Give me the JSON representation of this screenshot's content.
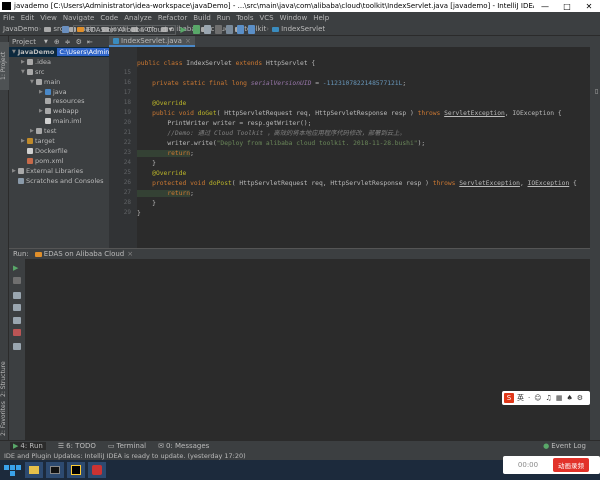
{
  "window": {
    "title": "javademo [C:\\Users\\Administrator\\idea-workspace\\javaDemo] - ...\\src\\main\\java\\com\\alibaba\\cloud\\toolkit\\IndexServlet.java [javademo] - IntelliJ IDEA (Admi...",
    "minimize": "—",
    "maximize": "□",
    "close": "✕"
  },
  "menu": [
    "File",
    "Edit",
    "View",
    "Navigate",
    "Code",
    "Analyze",
    "Refactor",
    "Build",
    "Run",
    "Tools",
    "VCS",
    "Window",
    "Help"
  ],
  "breadcrumbs": [
    "JavaDemo",
    "src",
    "main",
    "java",
    "com",
    "alibaba",
    "cloud",
    "toolkit",
    "IndexServlet"
  ],
  "run_config": "EDAS on Alibaba Cloud",
  "project_panel": {
    "title": "Project",
    "tree": [
      {
        "indent": 0,
        "arrow": "▼",
        "label": "JavaDemo",
        "sub": "C:\\Users\\Administrator\\idea-workspace\\JavaDemo",
        "icon": "folder",
        "selected": true
      },
      {
        "indent": 1,
        "arrow": "▶",
        "label": ".idea",
        "icon": "folder"
      },
      {
        "indent": 1,
        "arrow": "▼",
        "label": "src",
        "icon": "folder"
      },
      {
        "indent": 2,
        "arrow": "▼",
        "label": "main",
        "icon": "folder"
      },
      {
        "indent": 3,
        "arrow": "▶",
        "label": "java",
        "icon": "folder-blue"
      },
      {
        "indent": 3,
        "arrow": "",
        "label": "resources",
        "icon": "folder"
      },
      {
        "indent": 3,
        "arrow": "▶",
        "label": "webapp",
        "icon": "folder"
      },
      {
        "indent": 3,
        "arrow": "",
        "label": "main.iml",
        "icon": "file"
      },
      {
        "indent": 2,
        "arrow": "▶",
        "label": "test",
        "icon": "folder"
      },
      {
        "indent": 1,
        "arrow": "▶",
        "label": "target",
        "icon": "folder-orange"
      },
      {
        "indent": 1,
        "arrow": "",
        "label": "Dockerfile",
        "icon": "file"
      },
      {
        "indent": 1,
        "arrow": "",
        "label": "pom.xml",
        "icon": "file-m"
      },
      {
        "indent": 0,
        "arrow": "▶",
        "label": "External Libraries",
        "icon": "lib"
      },
      {
        "indent": 0,
        "arrow": "",
        "label": "Scratches and Consoles",
        "icon": "scratch"
      }
    ]
  },
  "editor": {
    "tab": "IndexServlet.java",
    "line_numbers": [
      "15",
      "16",
      "17",
      "18",
      "19",
      "20",
      "21",
      "22",
      "23",
      "24",
      "25",
      "26",
      "27",
      "28",
      "29"
    ],
    "code_lines": [
      [
        {
          "t": "public class ",
          "c": "kw"
        },
        {
          "t": "IndexServlet ",
          "c": ""
        },
        {
          "t": "extends ",
          "c": "kw"
        },
        {
          "t": "HttpServlet {",
          "c": ""
        }
      ],
      [],
      [
        {
          "t": "    private static final long ",
          "c": "kw"
        },
        {
          "t": "serialVersionUID",
          "c": "fd"
        },
        {
          "t": " = ",
          "c": ""
        },
        {
          "t": "-1123107822148577121L",
          "c": "num"
        },
        {
          "t": ";",
          "c": ""
        }
      ],
      [],
      [
        {
          "t": "    @Override",
          "c": "an"
        }
      ],
      [
        {
          "t": "    public void ",
          "c": "kw"
        },
        {
          "t": "doGet",
          "c": "an"
        },
        {
          "t": "( HttpServletRequest req, HttpServletResponse resp ) ",
          "c": ""
        },
        {
          "t": "throws ",
          "c": "kw"
        },
        {
          "t": "ServletException",
          "c": "ul"
        },
        {
          "t": ", IOException {",
          "c": ""
        }
      ],
      [
        {
          "t": "        PrintWriter writer = resp.getWriter();",
          "c": ""
        }
      ],
      [
        {
          "t": "        //Demo: 通过 Cloud Toolkit ，高效的将本地应用程序代码修改，部署到云上。",
          "c": "cm"
        }
      ],
      [
        {
          "t": "        writer.write(",
          "c": ""
        },
        {
          "t": "\"Deploy from alibaba cloud toolkit. 2018-11-28.bushi\"",
          "c": "st"
        },
        {
          "t": ");",
          "c": ""
        }
      ],
      [
        {
          "t": "        return",
          "c": "kw"
        },
        {
          "t": ";",
          "c": ""
        }
      ],
      [
        {
          "t": "    }",
          "c": ""
        }
      ],
      [
        {
          "t": "    @Override",
          "c": "an"
        }
      ],
      [
        {
          "t": "    protected void ",
          "c": "kw"
        },
        {
          "t": "doPost",
          "c": "an"
        },
        {
          "t": "( HttpServletRequest req, HttpServletResponse resp ) ",
          "c": ""
        },
        {
          "t": "throws ",
          "c": "kw"
        },
        {
          "t": "ServletException",
          "c": "ul"
        },
        {
          "t": ", ",
          "c": ""
        },
        {
          "t": "IOException",
          "c": "ul"
        },
        {
          "t": " {",
          "c": ""
        }
      ],
      [
        {
          "t": "        return",
          "c": "kw"
        },
        {
          "t": ";",
          "c": ""
        }
      ],
      [
        {
          "t": "    }",
          "c": ""
        }
      ],
      [
        {
          "t": "}",
          "c": ""
        }
      ]
    ]
  },
  "run_panel": {
    "label": "Run:",
    "config": "EDAS on Alibaba Cloud"
  },
  "side_tabs": {
    "project": "1: Project",
    "structure": "2: Structure",
    "favorites": "2: Favorites"
  },
  "bottom_tabs": [
    "4: Run",
    "6: TODO",
    "Terminal",
    "0: Messages"
  ],
  "event_log": "Event Log",
  "status": "IDE and Plugin Updates: IntelliJ IDEA is ready to update. (yesterday 17:20)",
  "ime": {
    "logo": "S",
    "glyphs": [
      "英",
      "·",
      "☺",
      "♫",
      "▦",
      "♠",
      "⚙",
      "☰"
    ]
  },
  "video": {
    "time": "00:00",
    "button": "动画录频"
  },
  "colors": {
    "accent": "#4a88c7",
    "selection": "#0d293e",
    "path_highlight": "#2f65ca"
  }
}
